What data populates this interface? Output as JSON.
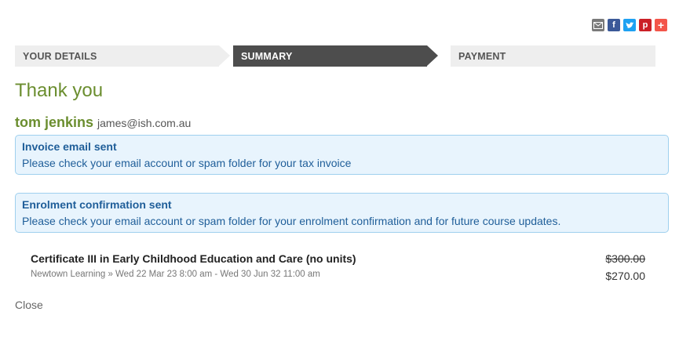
{
  "share": {
    "email_icon": "envelope-icon",
    "facebook_label": "f",
    "twitter_label": "t",
    "pinterest_label": "p",
    "more_label": "+"
  },
  "steps": [
    {
      "label": "YOUR DETAILS",
      "active": false
    },
    {
      "label": "SUMMARY",
      "active": true
    },
    {
      "label": "PAYMENT",
      "active": false
    }
  ],
  "heading": "Thank you",
  "user": {
    "name": "tom jenkins",
    "email": "james@ish.com.au"
  },
  "alerts": [
    {
      "title": "Invoice email sent",
      "message": "Please check your email account or spam folder for your tax invoice"
    },
    {
      "title": "Enrolment confirmation sent",
      "message": "Please check your email account or spam folder for your enrolment confirmation and for future course updates."
    }
  ],
  "course": {
    "title": "Certificate III in Early Childhood Education and Care (no units)",
    "meta": "Newtown Learning » Wed 22 Mar 23 8:00 am - Wed 30 Jun 32 11:00 am",
    "original_price": "$300.00",
    "price": "$270.00"
  },
  "close_label": "Close",
  "colors": {
    "brand_green": "#6b8e2f",
    "alert_bg": "#e8f4fd",
    "alert_text": "#1f5e99",
    "active_step": "#4d4d4d"
  }
}
